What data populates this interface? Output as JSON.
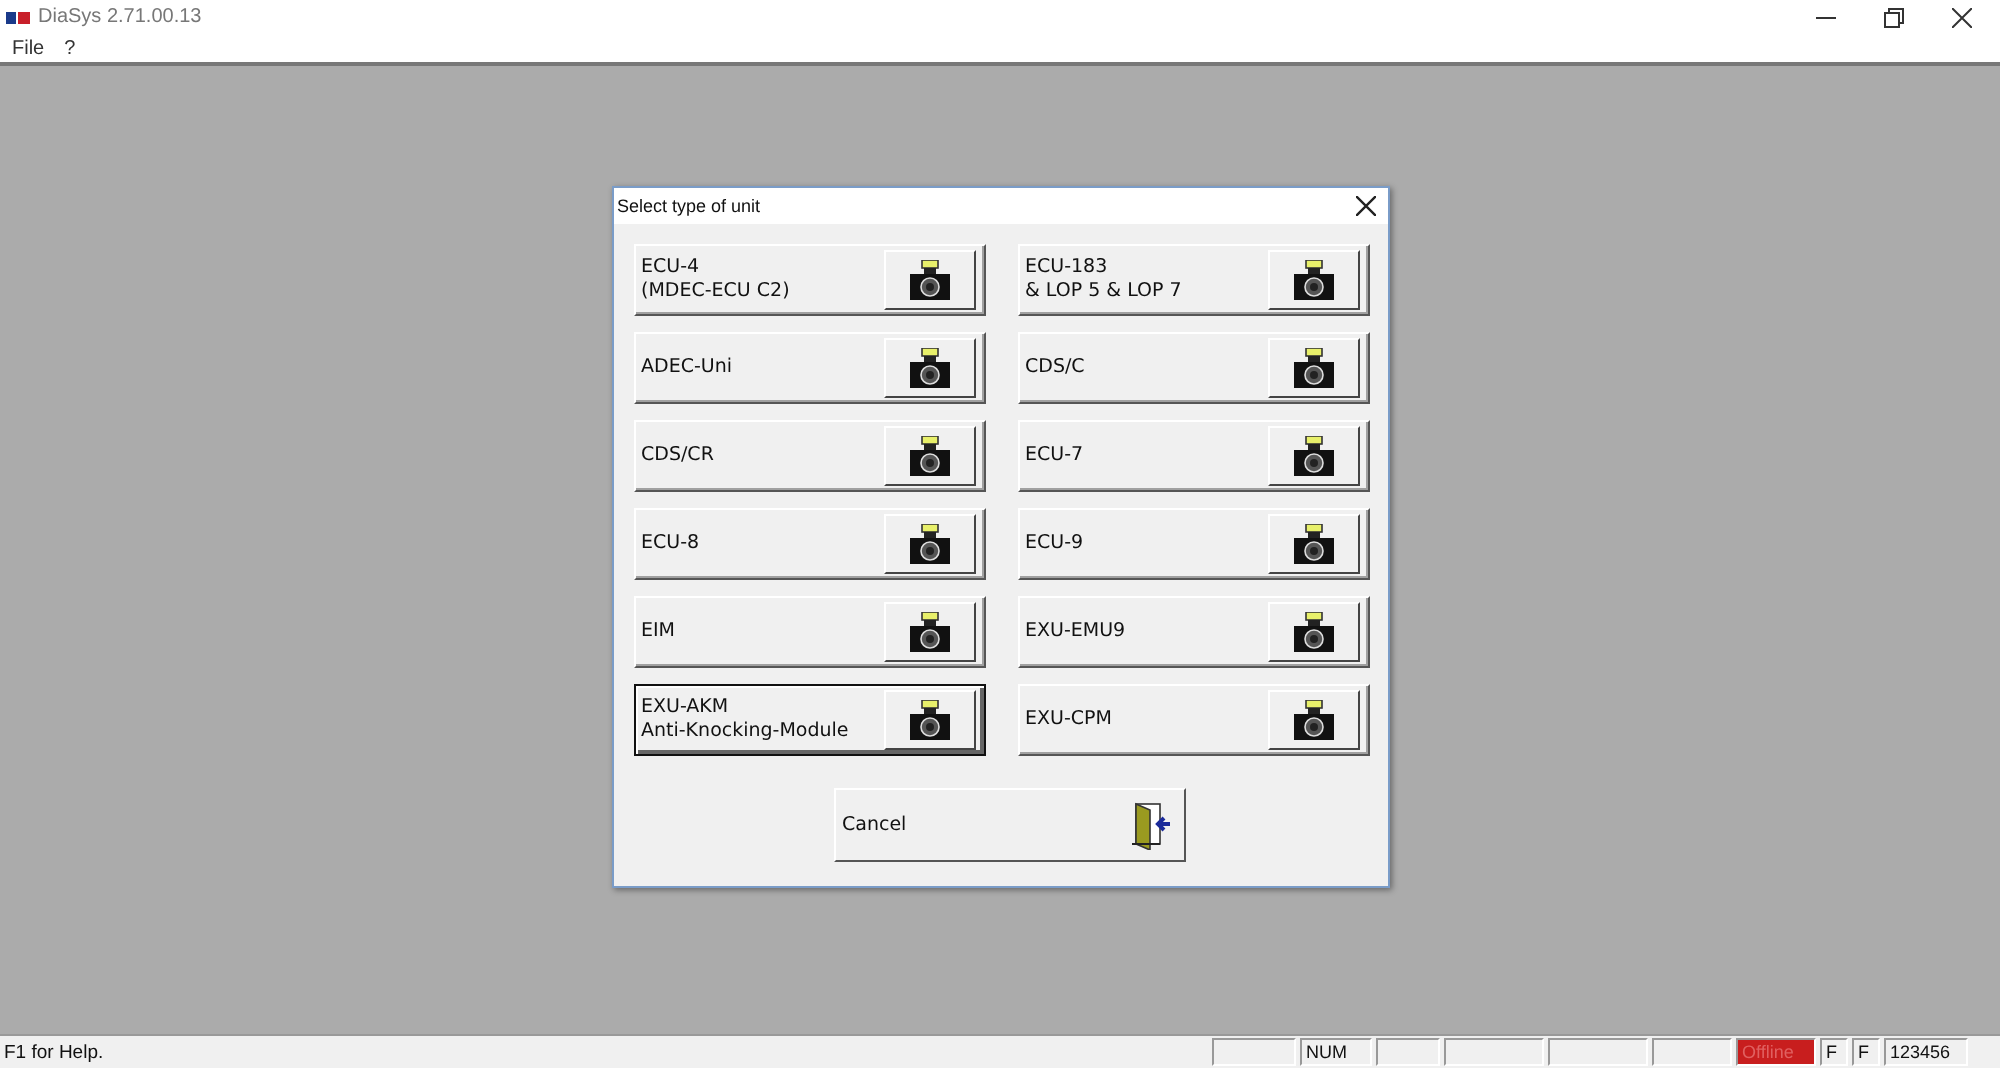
{
  "window": {
    "title": "DiaSys 2.71.00.13"
  },
  "menu": [
    "File",
    "?"
  ],
  "dialog": {
    "title": "Select type of unit",
    "units": [
      {
        "lines": [
          "ECU-4",
          "(MDEC-ECU C2)"
        ],
        "focused": false
      },
      {
        "lines": [
          "ECU-183",
          "& LOP 5 & LOP 7"
        ],
        "focused": false
      },
      {
        "lines": [
          "ADEC-Uni"
        ],
        "focused": false
      },
      {
        "lines": [
          "CDS/C"
        ],
        "focused": false
      },
      {
        "lines": [
          "CDS/CR"
        ],
        "focused": false
      },
      {
        "lines": [
          "ECU-7"
        ],
        "focused": false
      },
      {
        "lines": [
          "ECU-8"
        ],
        "focused": false
      },
      {
        "lines": [
          "ECU-9"
        ],
        "focused": false
      },
      {
        "lines": [
          "EIM"
        ],
        "focused": false
      },
      {
        "lines": [
          "EXU-EMU9"
        ],
        "focused": false
      },
      {
        "lines": [
          "EXU-AKM",
          "Anti-Knocking-Module"
        ],
        "focused": true
      },
      {
        "lines": [
          "EXU-CPM"
        ],
        "focused": false
      }
    ],
    "cancel": "Cancel"
  },
  "status_bar": {
    "help": "F1 for Help.",
    "panes": [
      {
        "highlight": false
      },
      {
        "text": "NUM",
        "highlight": false
      },
      {
        "highlight": false
      },
      {
        "highlight": false
      },
      {
        "highlight": false
      },
      {
        "highlight": false
      },
      {
        "text": "Offline",
        "highlight": true
      },
      {
        "text": "F",
        "highlight": false
      },
      {
        "text": "F",
        "highlight": false
      },
      {
        "text": "123456",
        "highlight": false
      }
    ]
  }
}
